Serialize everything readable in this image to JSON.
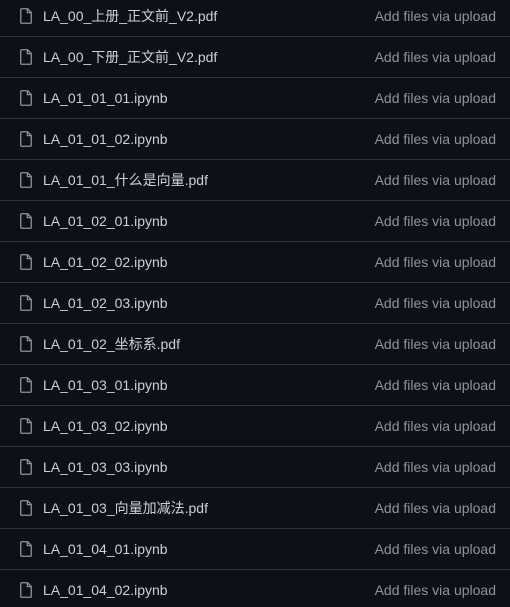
{
  "files": [
    {
      "icon": "file-icon",
      "name": "LA_00_上册_正文前_V2.pdf",
      "commit": "Add files via upload"
    },
    {
      "icon": "file-icon",
      "name": "LA_00_下册_正文前_V2.pdf",
      "commit": "Add files via upload"
    },
    {
      "icon": "file-icon",
      "name": "LA_01_01_01.ipynb",
      "commit": "Add files via upload"
    },
    {
      "icon": "file-icon",
      "name": "LA_01_01_02.ipynb",
      "commit": "Add files via upload"
    },
    {
      "icon": "file-icon",
      "name": "LA_01_01_什么是向量.pdf",
      "commit": "Add files via upload"
    },
    {
      "icon": "file-icon",
      "name": "LA_01_02_01.ipynb",
      "commit": "Add files via upload"
    },
    {
      "icon": "file-icon",
      "name": "LA_01_02_02.ipynb",
      "commit": "Add files via upload"
    },
    {
      "icon": "file-icon",
      "name": "LA_01_02_03.ipynb",
      "commit": "Add files via upload"
    },
    {
      "icon": "file-icon",
      "name": "LA_01_02_坐标系.pdf",
      "commit": "Add files via upload"
    },
    {
      "icon": "file-icon",
      "name": "LA_01_03_01.ipynb",
      "commit": "Add files via upload"
    },
    {
      "icon": "file-icon",
      "name": "LA_01_03_02.ipynb",
      "commit": "Add files via upload"
    },
    {
      "icon": "file-icon",
      "name": "LA_01_03_03.ipynb",
      "commit": "Add files via upload"
    },
    {
      "icon": "file-icon",
      "name": "LA_01_03_向量加减法.pdf",
      "commit": "Add files via upload"
    },
    {
      "icon": "file-icon",
      "name": "LA_01_04_01.ipynb",
      "commit": "Add files via upload"
    },
    {
      "icon": "file-icon",
      "name": "LA_01_04_02.ipynb",
      "commit": "Add files via upload"
    }
  ],
  "colors": {
    "background": "#0d1117",
    "border": "#30363d",
    "file_name": "#c9d1d9",
    "commit_message": "#8b949e",
    "icon": "#8b949e"
  }
}
